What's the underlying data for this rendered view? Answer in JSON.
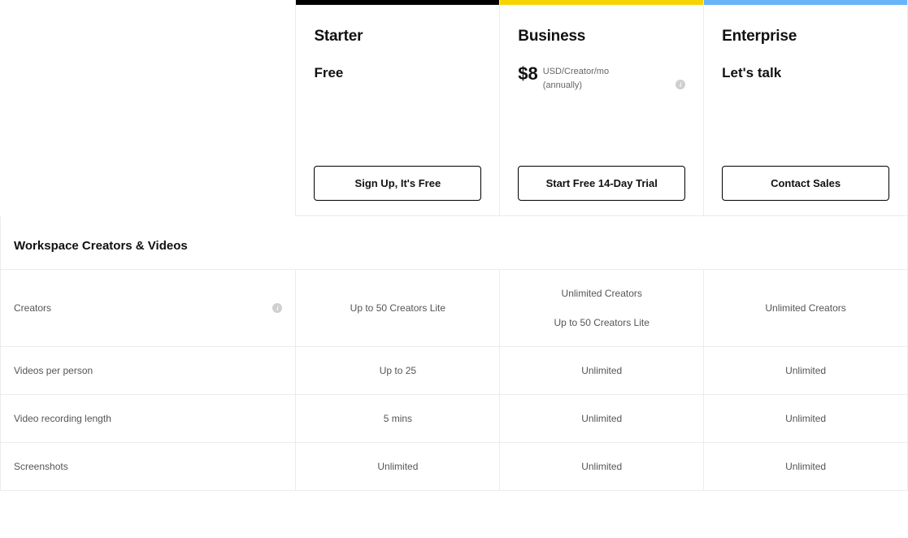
{
  "plans": {
    "starter": {
      "name": "Starter",
      "price_label": "Free",
      "cta": "Sign Up, It's Free"
    },
    "business": {
      "name": "Business",
      "price_amount": "$8",
      "price_unit": "USD/Creator/mo",
      "price_cycle": "(annually)",
      "cta": "Start Free 14-Day Trial"
    },
    "enterprise": {
      "name": "Enterprise",
      "price_label": "Let's talk",
      "cta": "Contact Sales"
    }
  },
  "section_title": "Workspace Creators & Videos",
  "features": {
    "creators": {
      "label": "Creators",
      "starter": "Up to 50 Creators Lite",
      "business_line1": "Unlimited Creators",
      "business_line2": "Up to 50 Creators Lite",
      "enterprise": "Unlimited Creators"
    },
    "videos_per_person": {
      "label": "Videos per person",
      "starter": "Up to 25",
      "business": "Unlimited",
      "enterprise": "Unlimited"
    },
    "recording_length": {
      "label": "Video recording length",
      "starter": "5 mins",
      "business": "Unlimited",
      "enterprise": "Unlimited"
    },
    "screenshots": {
      "label": "Screenshots",
      "starter": "Unlimited",
      "business": "Unlimited",
      "enterprise": "Unlimited"
    }
  }
}
